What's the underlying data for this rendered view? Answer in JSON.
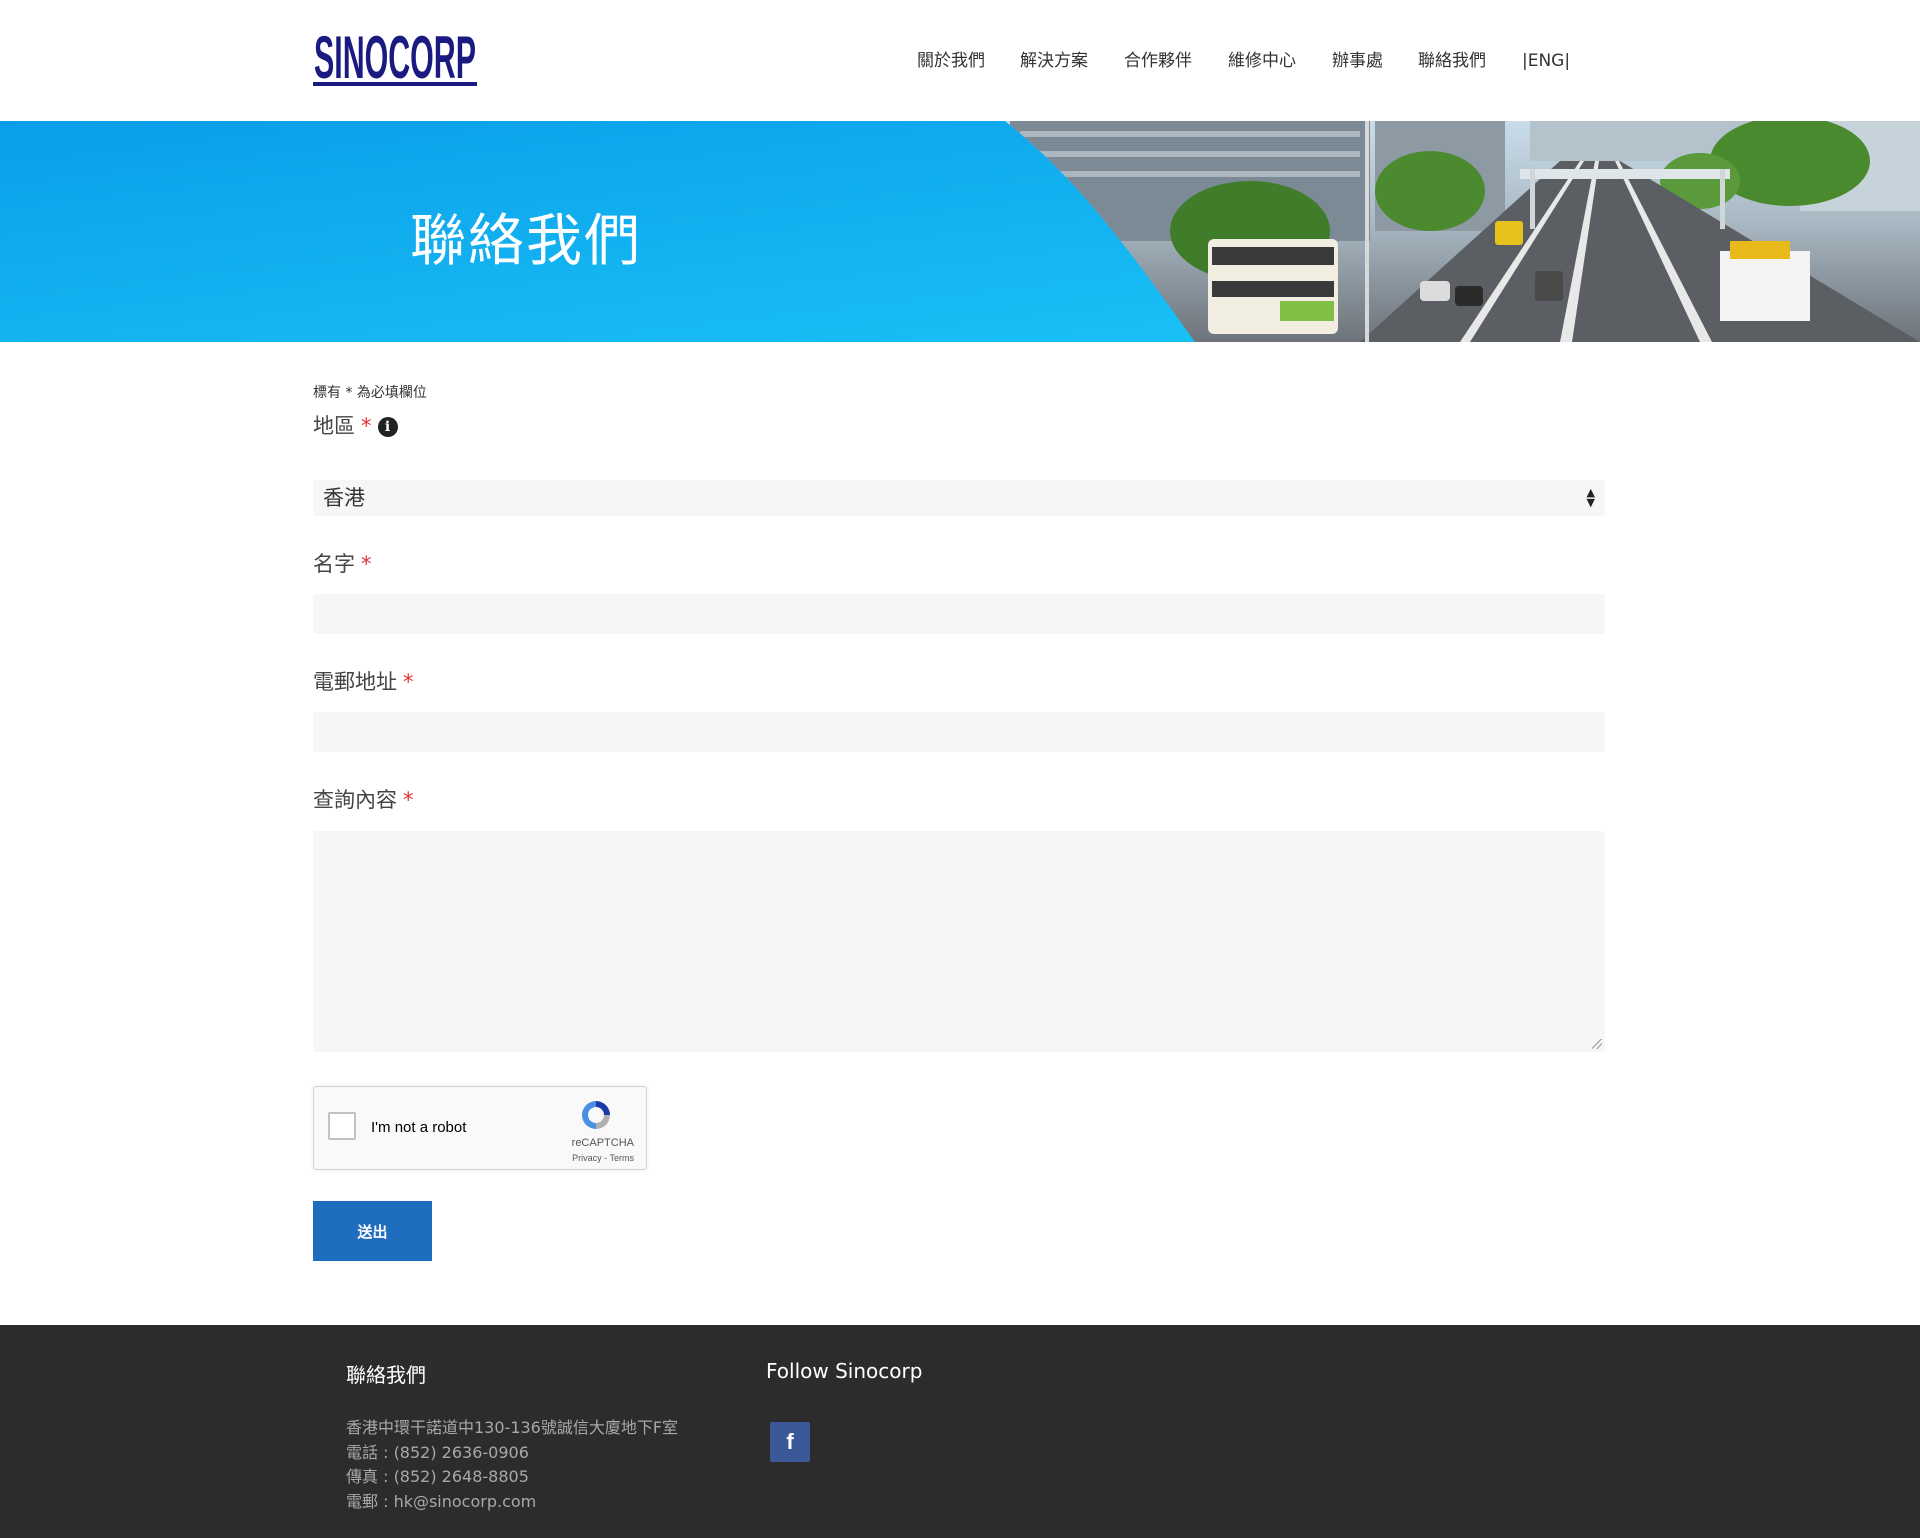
{
  "header": {
    "logo_text": "SINOCORP",
    "nav": [
      {
        "label": "關於我們"
      },
      {
        "label": "解決方案"
      },
      {
        "label": "合作夥伴"
      },
      {
        "label": "維修中心"
      },
      {
        "label": "辦事處"
      },
      {
        "label": "聯絡我們"
      },
      {
        "label": "|ENG|"
      }
    ]
  },
  "hero": {
    "title": "聯絡我們"
  },
  "form": {
    "required_note": "標有 * 為必填欄位",
    "region": {
      "label": "地區",
      "value": "香港"
    },
    "name": {
      "label": "名字",
      "value": ""
    },
    "email": {
      "label": "電郵地址",
      "value": ""
    },
    "inquiry": {
      "label": "查詢內容",
      "value": ""
    },
    "required_marker": "*",
    "info_icon": "i",
    "captcha": {
      "label": "I'm not a robot",
      "brand": "reCAPTCHA",
      "links": "Privacy - Terms"
    },
    "submit_label": "送出"
  },
  "footer": {
    "contact_title": "聯絡我們",
    "address": "香港中環干諾道中130-136號誠信大廈地下F室",
    "phone": "電話 : (852) 2636-0906",
    "fax": "傳真 : (852) 2648-8805",
    "email": "電郵 : hk@sinocorp.com",
    "follow_title": "Follow Sinocorp",
    "facebook_glyph": "f"
  },
  "colors": {
    "brand_navy": "#1a1a80",
    "hero_blue": "#14aaf0",
    "submit_blue": "#1f6dbf",
    "footer_bg": "#2c2c2c",
    "facebook": "#3b5998",
    "required": "#d33333"
  },
  "icons": {
    "info": "info-circle-icon",
    "select": "select-arrows-icon",
    "captcha": "recaptcha-logo-icon",
    "social": "facebook-icon"
  }
}
